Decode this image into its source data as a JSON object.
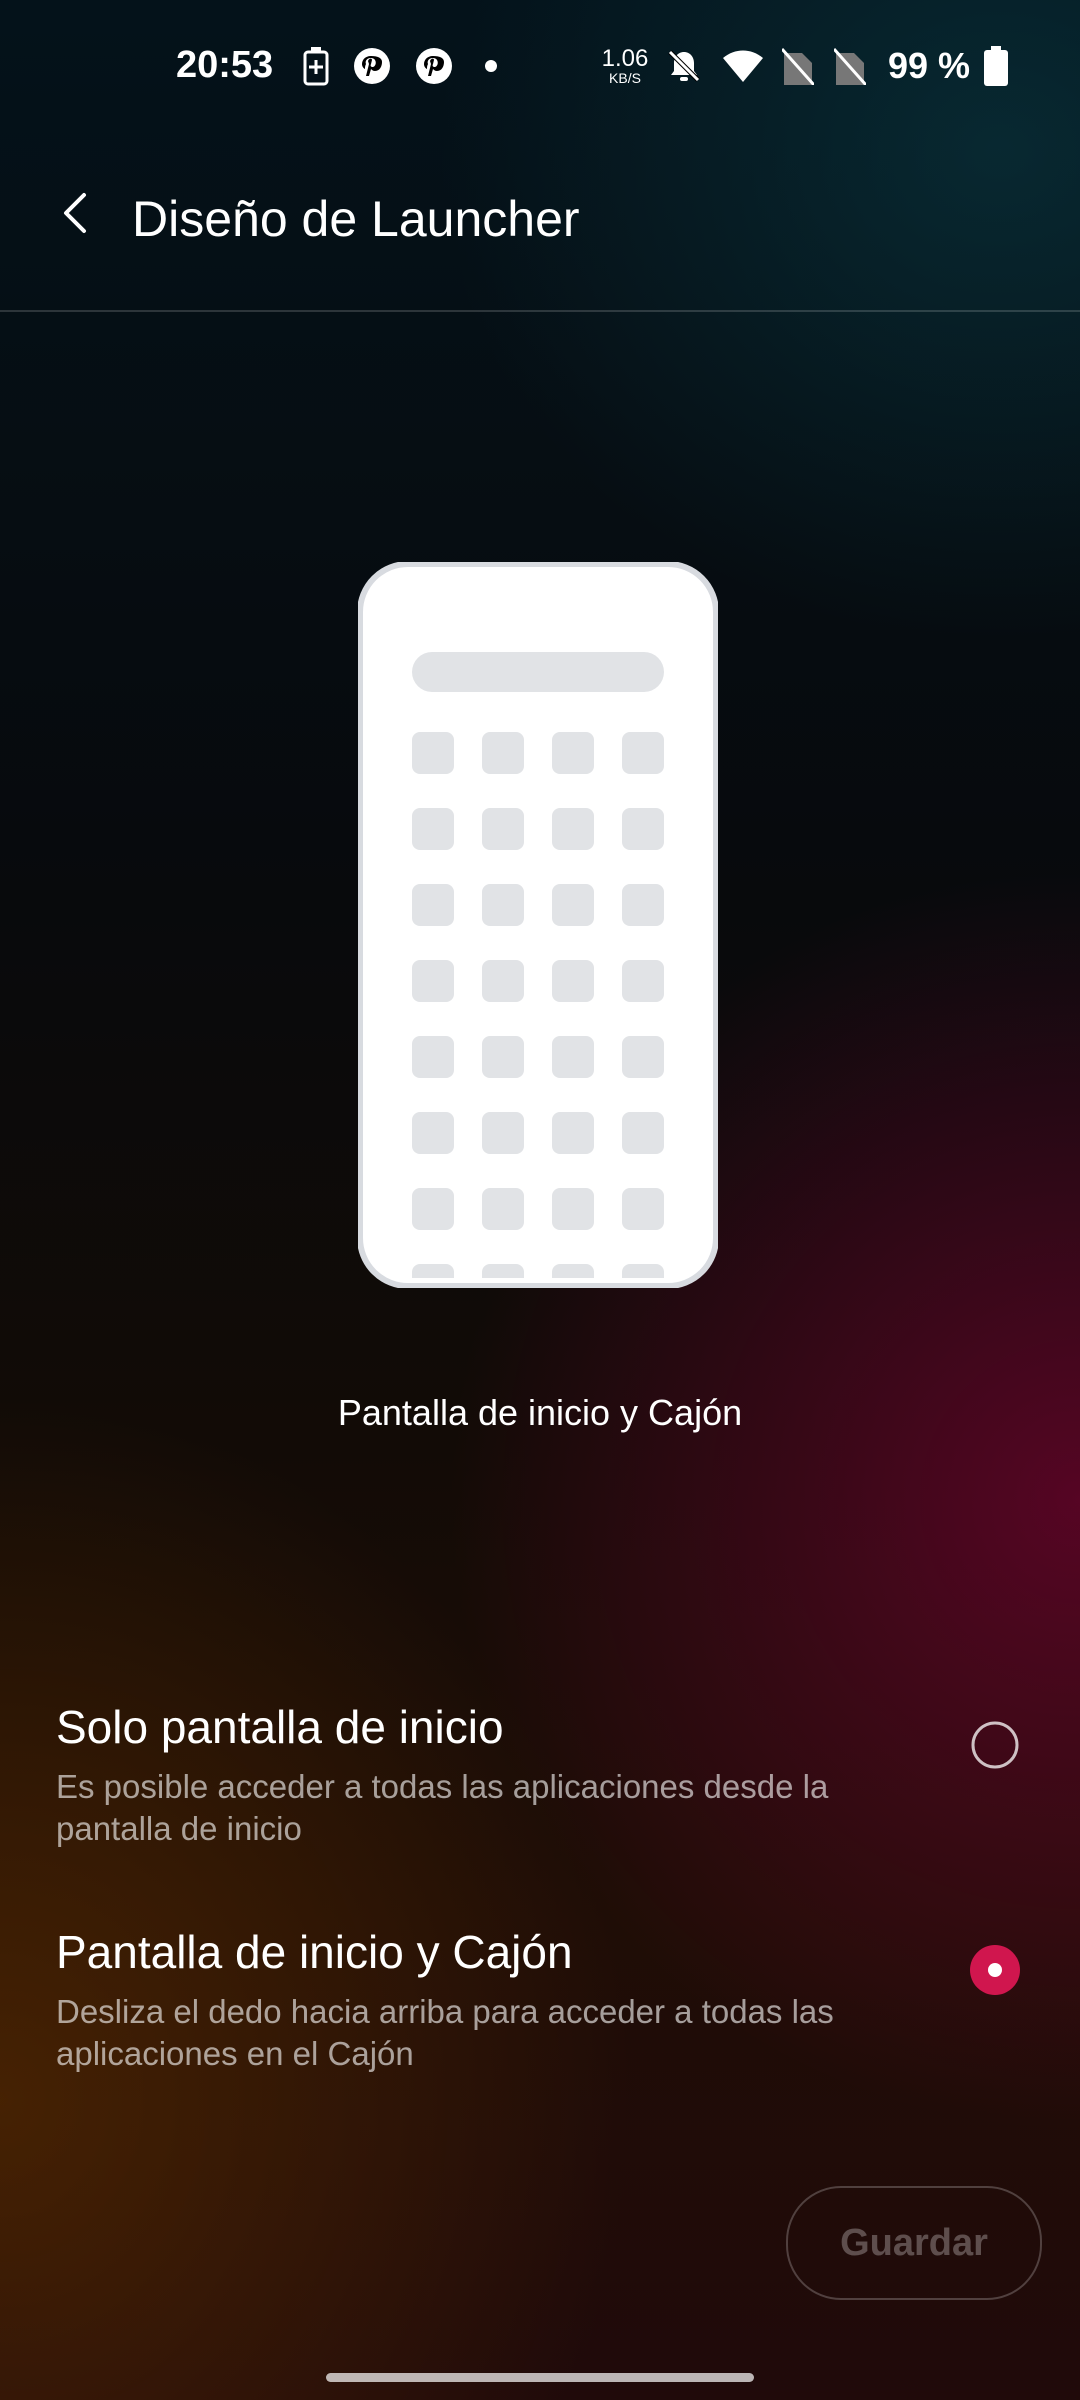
{
  "status_bar": {
    "time": "20:53",
    "net_speed_value": "1.06",
    "net_speed_unit": "KB/S",
    "battery_text": "99 %",
    "icons": [
      "battery-saver-icon",
      "pinterest-icon",
      "pinterest-icon",
      "dot-icon",
      "bell-off-icon",
      "wifi-icon",
      "no-sim-icon",
      "no-sim-icon",
      "battery-icon"
    ]
  },
  "header": {
    "title": "Diseño de Launcher",
    "back_icon": "back-arrow-icon"
  },
  "preview": {
    "caption": "Pantalla de inicio y Cajón"
  },
  "options": [
    {
      "title": "Solo pantalla de inicio",
      "description": "Es posible acceder a todas las aplicaciones desde la pantalla de inicio",
      "selected": false
    },
    {
      "title": "Pantalla de inicio y Cajón",
      "description": "Desliza el dedo hacia arriba para acceder a todas las aplicaciones en el Cajón",
      "selected": true
    }
  ],
  "actions": {
    "save_label": "Guardar"
  },
  "colors": {
    "accent": "#d0164e"
  }
}
